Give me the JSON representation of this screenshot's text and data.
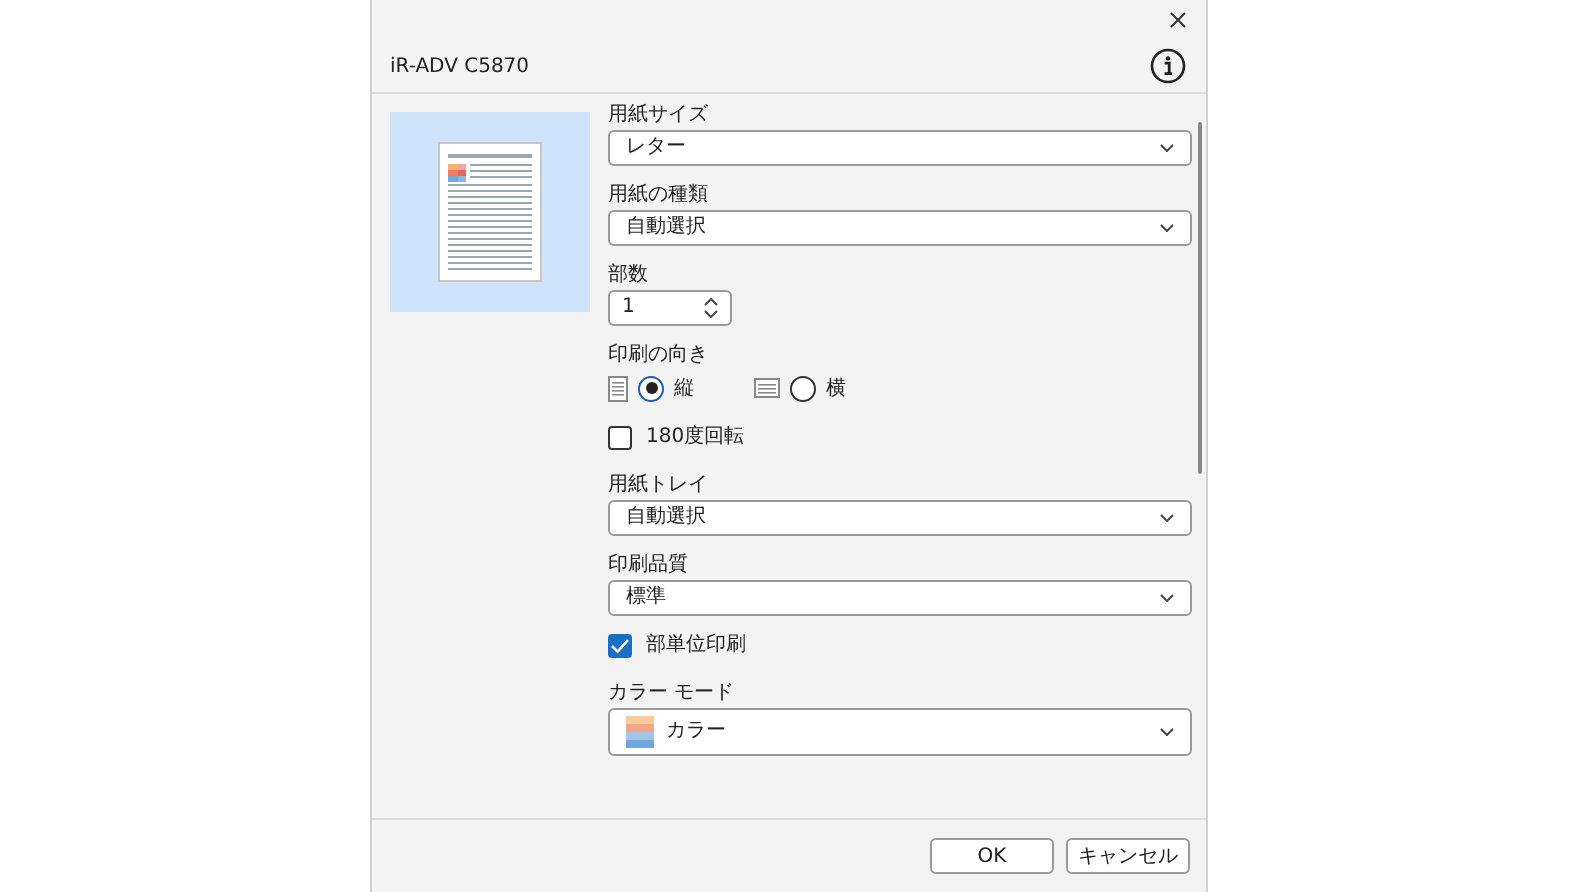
{
  "window": {
    "title": "iR-ADV C5870"
  },
  "settings": [
    {
      "kind": "select",
      "label": "用紙サイズ",
      "value": "レター"
    },
    {
      "kind": "select",
      "label": "用紙の種類",
      "value": "自動選択"
    },
    {
      "kind": "spinner",
      "label": "部数",
      "value": "1"
    },
    {
      "kind": "radio",
      "label": "印刷の向き",
      "options": [
        {
          "label": "縦",
          "selected": true
        },
        {
          "label": "横",
          "selected": false
        }
      ]
    },
    {
      "kind": "checkbox",
      "label": "180度回転",
      "checked": false
    },
    {
      "kind": "select",
      "label": "用紙トレイ",
      "value": "自動選択"
    },
    {
      "kind": "select",
      "label": "印刷品質",
      "value": "標準"
    },
    {
      "kind": "checkbox",
      "label": "部単位印刷",
      "checked": true
    },
    {
      "kind": "color-select",
      "label": "カラー モード",
      "value": "カラー"
    }
  ],
  "buttons": [
    "OK",
    "キャンセル"
  ]
}
